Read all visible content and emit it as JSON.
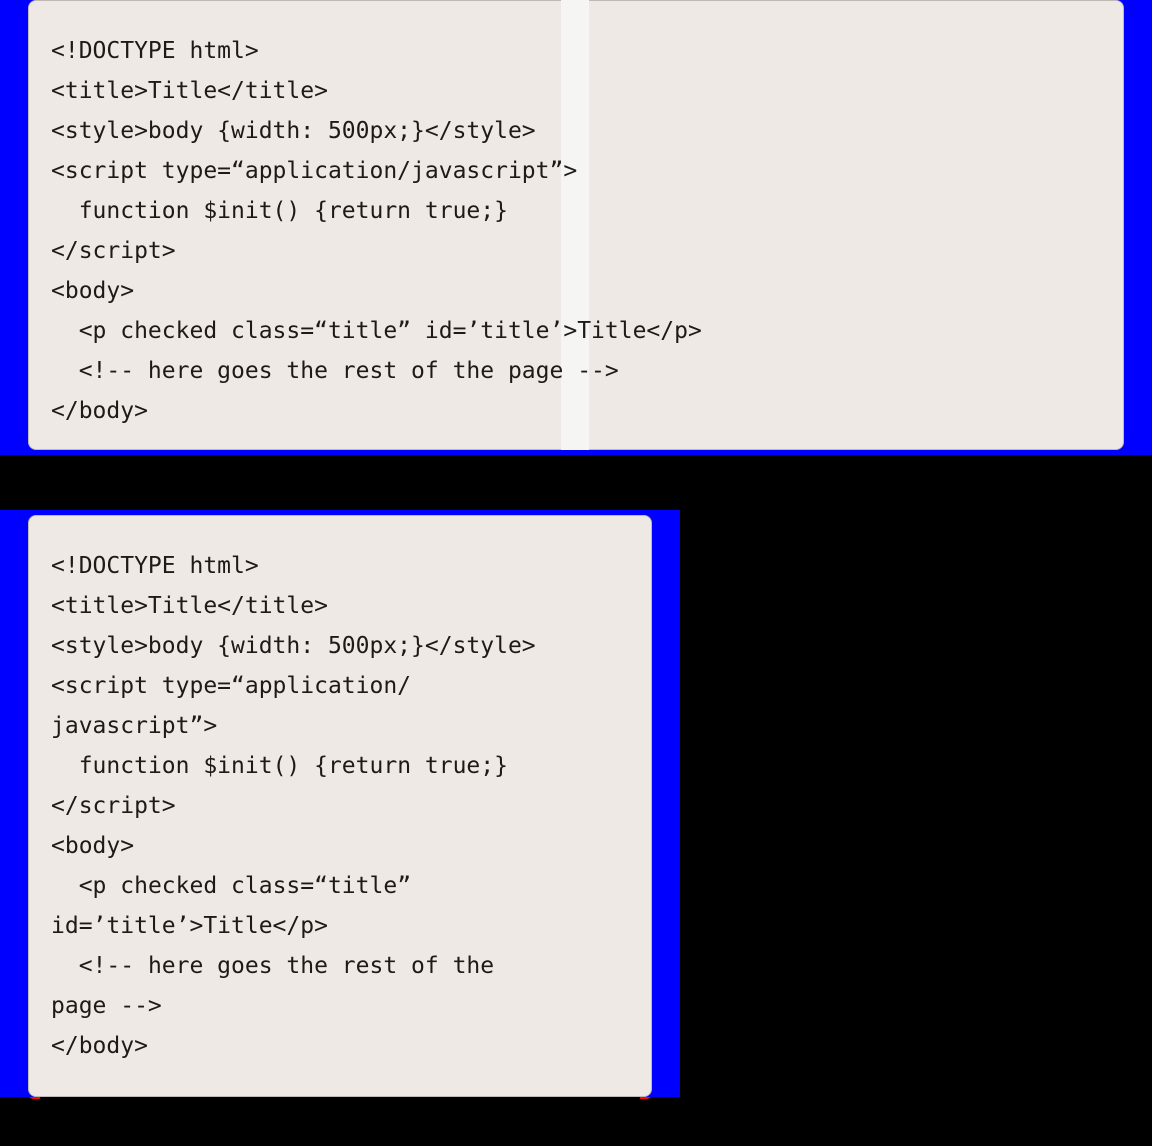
{
  "codeblock1": {
    "line1": "<!DOCTYPE html>",
    "line2": "<title>Title</title>",
    "line3": "<style>body {width: 500px;}</style>",
    "line4": "<script type=“application/javascript”>",
    "line5": "  function $init() {return true;}",
    "line6": "</script>",
    "line7": "<body>",
    "line8": "  <p checked class=“title” id=’title’>Title</p>",
    "line9": "  <!-- here goes the rest of the page -->",
    "line10": "</body>"
  },
  "codeblock2": {
    "line1": "<!DOCTYPE html>",
    "line2": "<title>Title</title>",
    "line3": "<style>body {width: 500px;}</style>",
    "line4": "<script type=“application/",
    "line5": "javascript”>",
    "line6": "  function $init() {return true;}",
    "line7": "</script>",
    "line8": "<body>",
    "line9": "  <p checked class=“title”",
    "line10": "id=’title’>Title</p>",
    "line11": "  <!-- here goes the rest of the",
    "line12": "page -->",
    "line13": "</body>"
  }
}
